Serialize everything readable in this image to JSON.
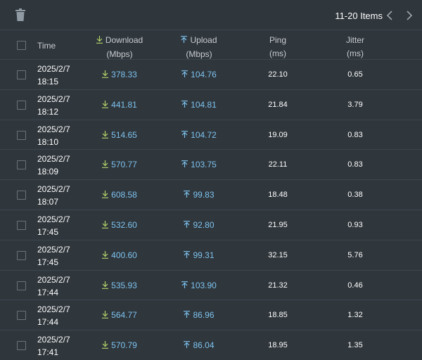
{
  "toolbar": {
    "items_label": "11-20 Items",
    "delete_icon": "trash-icon",
    "prev_icon": "chevron-left-icon",
    "next_icon": "chevron-right-icon"
  },
  "columns": {
    "time": "Time",
    "download": "Download",
    "download_unit": "(Mbps)",
    "upload": "Upload",
    "upload_unit": "(Mbps)",
    "ping": "Ping",
    "ping_unit": "(ms)",
    "jitter": "Jitter",
    "jitter_unit": "(ms)"
  },
  "colors": {
    "background": "#2f363c",
    "speed_text": "#7ec3ef",
    "download_icon": "#b5d46a",
    "upload_icon": "#7ec3ef"
  },
  "rows": [
    {
      "date": "2025/2/7",
      "time": "18:15",
      "download": "378.33",
      "upload": "104.76",
      "ping": "22.10",
      "jitter": "0.65"
    },
    {
      "date": "2025/2/7",
      "time": "18:12",
      "download": "441.81",
      "upload": "104.81",
      "ping": "21.84",
      "jitter": "3.79"
    },
    {
      "date": "2025/2/7",
      "time": "18:10",
      "download": "514.65",
      "upload": "104.72",
      "ping": "19.09",
      "jitter": "0.83"
    },
    {
      "date": "2025/2/7",
      "time": "18:09",
      "download": "570.77",
      "upload": "103.75",
      "ping": "22.11",
      "jitter": "0.83"
    },
    {
      "date": "2025/2/7",
      "time": "18:07",
      "download": "608.58",
      "upload": "99.83",
      "ping": "18.48",
      "jitter": "0.38"
    },
    {
      "date": "2025/2/7",
      "time": "17:45",
      "download": "532.60",
      "upload": "92.80",
      "ping": "21.95",
      "jitter": "0.93"
    },
    {
      "date": "2025/2/7",
      "time": "17:45",
      "download": "400.60",
      "upload": "99.31",
      "ping": "32.15",
      "jitter": "5.76"
    },
    {
      "date": "2025/2/7",
      "time": "17:44",
      "download": "535.93",
      "upload": "103.90",
      "ping": "21.32",
      "jitter": "0.46"
    },
    {
      "date": "2025/2/7",
      "time": "17:44",
      "download": "564.77",
      "upload": "86.96",
      "ping": "18.85",
      "jitter": "1.32"
    },
    {
      "date": "2025/2/7",
      "time": "17:41",
      "download": "570.79",
      "upload": "86.04",
      "ping": "18.95",
      "jitter": "1.35"
    }
  ]
}
